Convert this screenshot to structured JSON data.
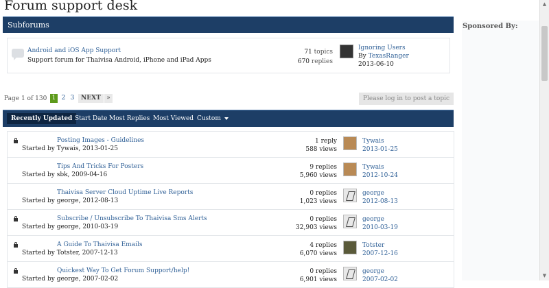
{
  "page_title": "Forum support desk",
  "sidebar": {
    "sponsored_label": "Sponsored By:"
  },
  "subforums": {
    "heading": "Subforums",
    "item": {
      "name": "Android and iOS App Support",
      "description": "Support forum for Thaivisa Android, iPhone and iPad Apps",
      "topics_count": "71",
      "topics_label": "topics",
      "replies_count": "670",
      "replies_label": "replies",
      "last_post_title": "Ignoring Users",
      "last_post_by_prefix": "By",
      "last_post_author": "TexasRanger",
      "last_post_date": "2013-06-10"
    }
  },
  "pagination": {
    "label": "Page 1 of 130",
    "pages": [
      "1",
      "2",
      "3"
    ],
    "active_page": "1",
    "next_label": "NEXT",
    "last_label": "»",
    "login_button": "Please log in to post a topic"
  },
  "sort_tabs": {
    "items": [
      "Recently Updated",
      "Start Date",
      "Most Replies",
      "Most Viewed",
      "Custom"
    ],
    "active": "Recently Updated"
  },
  "topics": [
    {
      "locked": true,
      "title": "Posting Images - Guidelines",
      "started": "Started by Tywais, 2013-01-25",
      "replies": "1 reply",
      "views": "588 views",
      "last_user": "Tywais",
      "last_date": "2013-01-25",
      "avatar": "brown"
    },
    {
      "locked": false,
      "title": "Tips And Tricks For Posters",
      "started": "Started by sbk, 2009-04-16",
      "replies": "9 replies",
      "views": "5,960 views",
      "last_user": "Tywais",
      "last_date": "2012-10-24",
      "avatar": "brown"
    },
    {
      "locked": false,
      "title": "Thaivisa Server Cloud Uptime Live Reports",
      "started": "Started by george, 2012-08-13",
      "replies": "0 replies",
      "views": "1,023 views",
      "last_user": "george",
      "last_date": "2012-08-13",
      "avatar": "gray"
    },
    {
      "locked": true,
      "title": "Subscribe / Unsubscribe To Thaivisa Sms Alerts",
      "started": "Started by george, 2010-03-19",
      "replies": "0 replies",
      "views": "32,903 views",
      "last_user": "george",
      "last_date": "2010-03-19",
      "avatar": "gray"
    },
    {
      "locked": true,
      "title": "A Guide To Thaivisa Emails",
      "started": "Started by Totster, 2007-12-13",
      "replies": "4 replies",
      "views": "6,070 views",
      "last_user": "Totster",
      "last_date": "2007-12-16",
      "avatar": "dark"
    },
    {
      "locked": true,
      "title": "Quickest Way To Get Forum Support/help!",
      "started": "Started by george, 2007-02-02",
      "replies": "0 replies",
      "views": "6,901 views",
      "last_user": "george",
      "last_date": "2007-02-02",
      "avatar": "gray"
    }
  ]
}
